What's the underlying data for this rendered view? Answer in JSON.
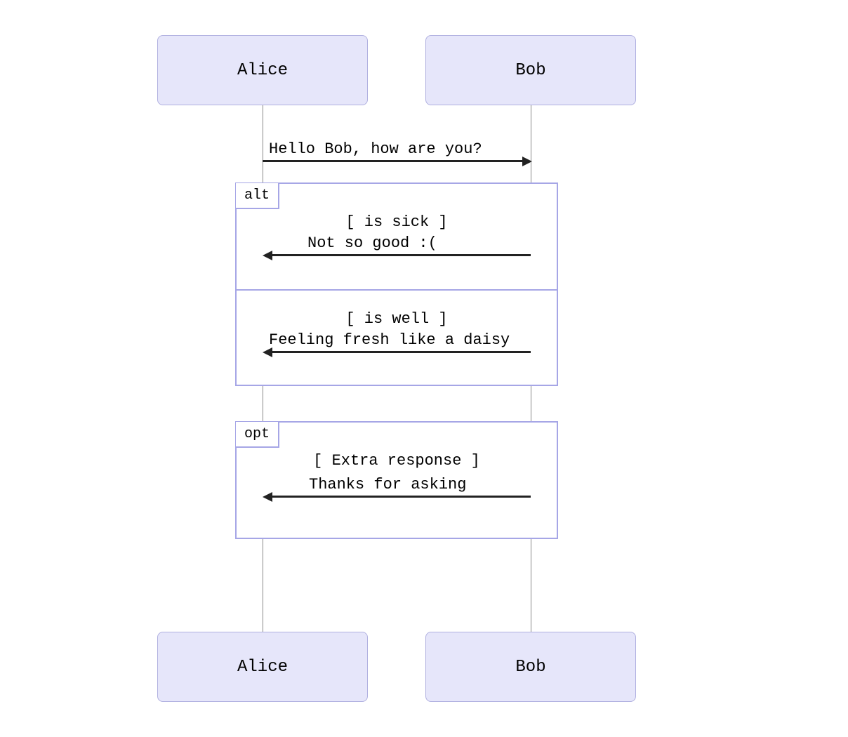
{
  "actors": {
    "alice": "Alice",
    "bob": "Bob"
  },
  "messages": {
    "m1": "Hello Bob, how are you?",
    "m2": "Not so good :(",
    "m3": "Feeling fresh like a daisy",
    "m4": "Thanks for asking"
  },
  "fragments": {
    "alt": {
      "label": "alt",
      "cond1": "[ is sick ]",
      "cond2": "[ is well ]"
    },
    "opt": {
      "label": "opt",
      "cond": "[ Extra response ]"
    }
  },
  "colors": {
    "actorFill": "#e6e6fa",
    "actorBorder": "#b0b0e0",
    "fragBorder": "#a6a6e6",
    "arrow": "#222222",
    "lifeline": "#888888"
  }
}
